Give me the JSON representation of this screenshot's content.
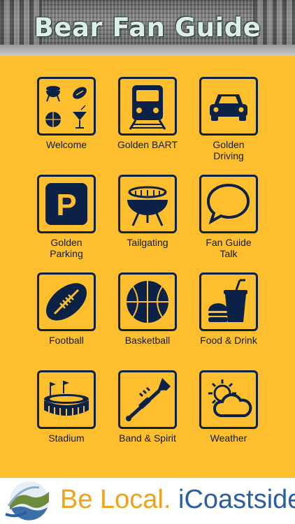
{
  "header": {
    "title": "Bear Fan Guide"
  },
  "tiles": [
    {
      "label": "Welcome",
      "icon": "welcome-collage-icon"
    },
    {
      "label": "Golden BART",
      "icon": "train-icon"
    },
    {
      "label": "Golden\nDriving",
      "icon": "car-icon"
    },
    {
      "label": "Golden\nParking",
      "icon": "parking-icon"
    },
    {
      "label": "Tailgating",
      "icon": "grill-icon"
    },
    {
      "label": "Fan Guide\nTalk",
      "icon": "speech-bubble-icon"
    },
    {
      "label": "Football",
      "icon": "football-icon"
    },
    {
      "label": "Basketball",
      "icon": "basketball-icon"
    },
    {
      "label": "Food & Drink",
      "icon": "burger-drink-icon"
    },
    {
      "label": "Stadium",
      "icon": "stadium-icon"
    },
    {
      "label": "Band & Spirit",
      "icon": "trumpet-icon"
    },
    {
      "label": "Weather",
      "icon": "weather-icon"
    }
  ],
  "footer": {
    "brand_part1": "Be Local.",
    "brand_part2": "iCoastside"
  },
  "colors": {
    "background": "#fdbf2d",
    "icon": "#0b2246",
    "brand_orange": "#f0a31a",
    "brand_blue": "#2b5ea3"
  }
}
